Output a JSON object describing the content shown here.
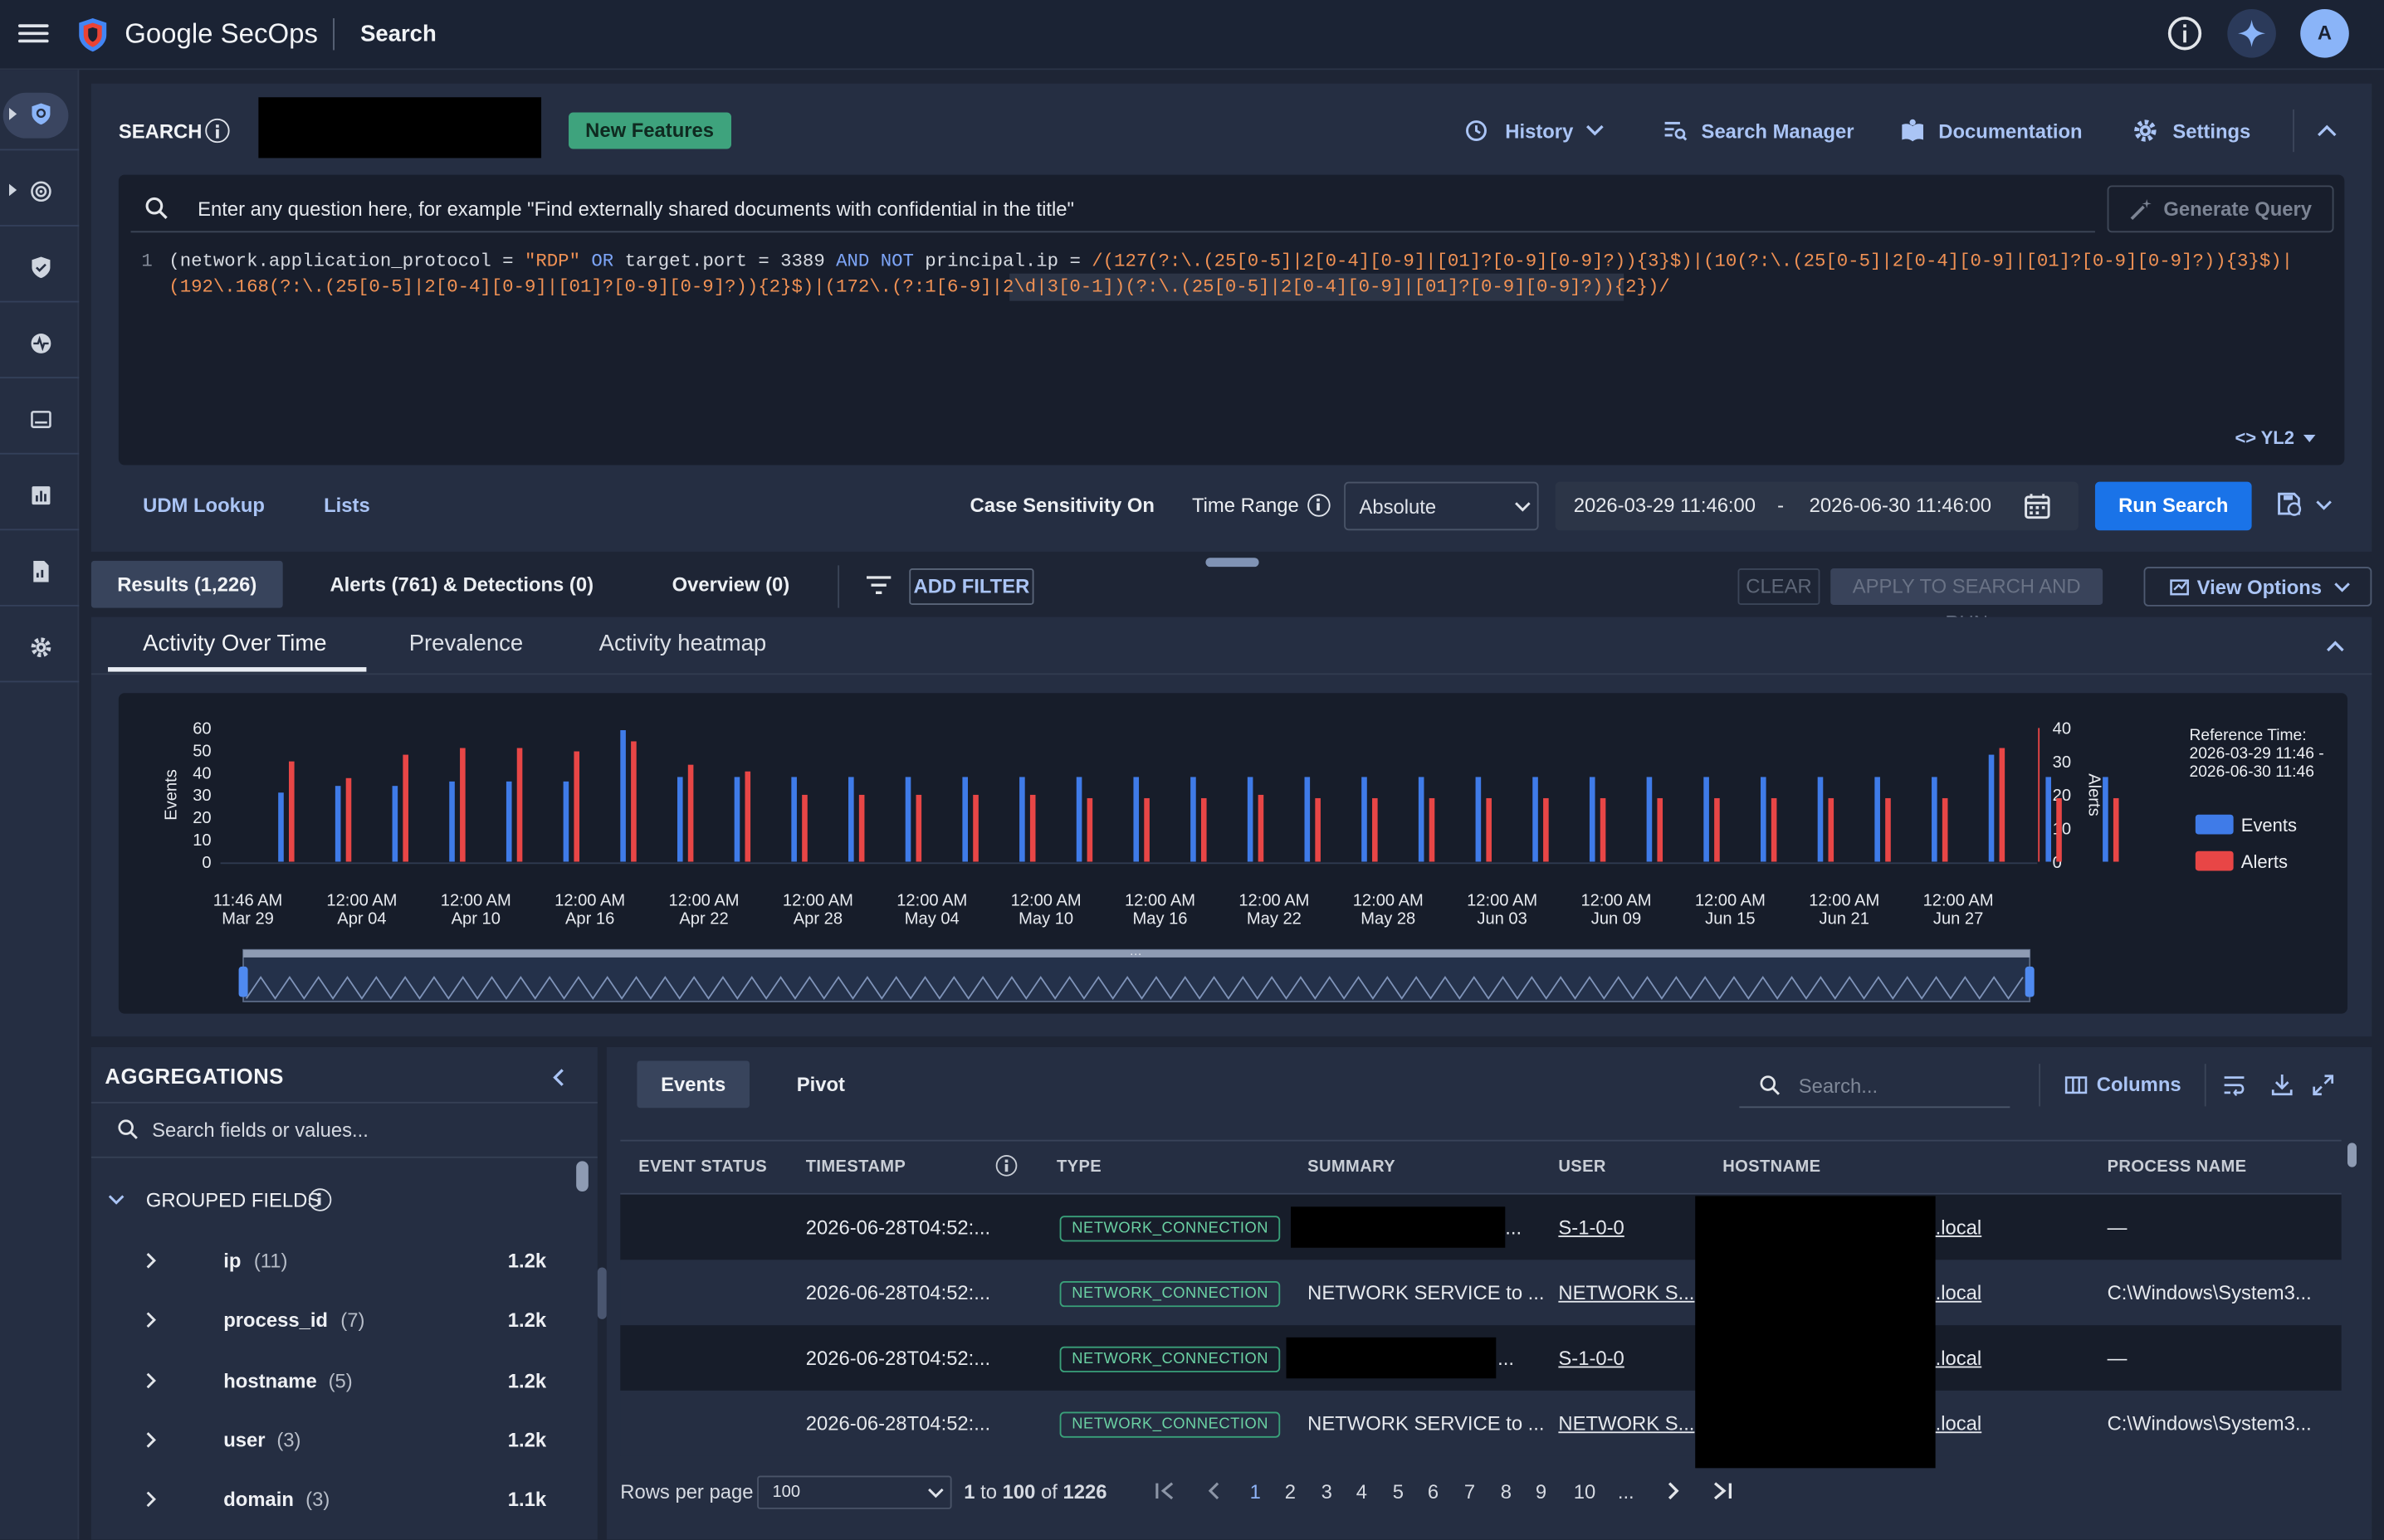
{
  "app": {
    "brand": "Google SecOps",
    "page_title": "Search",
    "avatar_letter": "A"
  },
  "search": {
    "label": "SEARCH",
    "new_features": "New Features",
    "history": "History",
    "search_manager": "Search Manager",
    "documentation": "Documentation",
    "settings": "Settings",
    "nl_placeholder": "Enter any question here, for example \"Find externally shared documents with confidential in the title\"",
    "generate_query": "Generate Query",
    "line_number": "1",
    "query_part1": "(network.application_protocol = ",
    "query_rdp": "\"RDP\"",
    "query_or": " OR ",
    "query_port": "target.port = 3389",
    "query_and_not": " AND NOT ",
    "query_principal": "principal.ip = ",
    "query_regex1": "/(127(?:\\.(25[0-5]|2[0-4][0-9]|[01]?[0-9][0-9]?)){3}$)|(10(?:\\.(25[0-5]|2[0-4][0-9]|[01]?[0-9][0-9]?)){3}$)|",
    "query_regex2": "(192\\.168(?:\\.(25[0-5]|2[0-4][0-9]|[01]?[0-9][0-9]?)){2}$)|(172\\.(?:1[6-9]|2\\d|3[0-1])(?:\\.(25[0-5]|2[0-4][0-9]|[01]?[0-9][0-9]?)){2})/",
    "syntax": "YL2",
    "udm_lookup": "UDM Lookup",
    "lists": "Lists",
    "case_sensitivity": "Case Sensitivity On",
    "time_range_label": "Time Range",
    "time_range_value": "Absolute",
    "start": "2026-03-29 11:46:00",
    "dash": "-",
    "end": "2026-06-30 11:46:00",
    "run_search": "Run Search"
  },
  "results_tabs": {
    "results": "Results (1,226)",
    "alerts": "Alerts (761) & Detections (0)",
    "overview": "Overview (0)",
    "add_filter": "ADD FILTER",
    "clear": "CLEAR",
    "apply": "APPLY TO SEARCH AND RUN",
    "view_options": "View Options"
  },
  "chart_tabs": {
    "activity": "Activity Over Time",
    "prevalence": "Prevalence",
    "heatmap": "Activity heatmap"
  },
  "chart_data": {
    "type": "bar",
    "ylabel_left": "Events",
    "ylabel_right": "Alerts",
    "yticks_left": [
      "60",
      "50",
      "40",
      "30",
      "20",
      "10",
      "0"
    ],
    "yticks_right": [
      "40",
      "30",
      "20",
      "10",
      "0"
    ],
    "ylim_left": [
      0,
      60
    ],
    "ylim_right": [
      0,
      40
    ],
    "xticks": [
      {
        "t": "11:46 AM",
        "d": "Mar 29"
      },
      {
        "t": "12:00 AM",
        "d": "Apr 04"
      },
      {
        "t": "12:00 AM",
        "d": "Apr 10"
      },
      {
        "t": "12:00 AM",
        "d": "Apr 16"
      },
      {
        "t": "12:00 AM",
        "d": "Apr 22"
      },
      {
        "t": "12:00 AM",
        "d": "Apr 28"
      },
      {
        "t": "12:00 AM",
        "d": "May 04"
      },
      {
        "t": "12:00 AM",
        "d": "May 10"
      },
      {
        "t": "12:00 AM",
        "d": "May 16"
      },
      {
        "t": "12:00 AM",
        "d": "May 22"
      },
      {
        "t": "12:00 AM",
        "d": "May 28"
      },
      {
        "t": "12:00 AM",
        "d": "Jun 03"
      },
      {
        "t": "12:00 AM",
        "d": "Jun 09"
      },
      {
        "t": "12:00 AM",
        "d": "Jun 15"
      },
      {
        "t": "12:00 AM",
        "d": "Jun 21"
      },
      {
        "t": "12:00 AM",
        "d": "Jun 27"
      }
    ],
    "series": [
      {
        "name": "Events",
        "color": "#3f7be8",
        "values": [
          31,
          34,
          34,
          36,
          36,
          36,
          59,
          38,
          38,
          38,
          38,
          38,
          38,
          38,
          38,
          38,
          38,
          38,
          38,
          38,
          38,
          38,
          38,
          38,
          38,
          38,
          38,
          38,
          38,
          38,
          48,
          38,
          38
        ]
      },
      {
        "name": "Alerts",
        "color": "#e84646",
        "values": [
          30,
          25,
          32,
          34,
          34,
          33,
          36,
          29,
          27,
          20,
          20,
          20,
          20,
          20,
          19,
          19,
          19,
          20,
          19,
          19,
          19,
          19,
          19,
          19,
          19,
          19,
          19,
          19,
          19,
          19,
          34,
          19,
          19
        ]
      }
    ],
    "reference_label": "Reference Time:",
    "reference_start": "2026-03-29 11:46 -",
    "reference_end": "2026-06-30 11:46"
  },
  "aggregations": {
    "title": "AGGREGATIONS",
    "search_placeholder": "Search fields or values...",
    "grouped_fields": "GROUPED FIELDS",
    "fields": [
      {
        "name": "ip",
        "count": "(11)",
        "value": "1.2k"
      },
      {
        "name": "process_id",
        "count": "(7)",
        "value": "1.2k"
      },
      {
        "name": "hostname",
        "count": "(5)",
        "value": "1.2k"
      },
      {
        "name": "user",
        "count": "(3)",
        "value": "1.2k"
      },
      {
        "name": "domain",
        "count": "(3)",
        "value": "1.1k"
      }
    ]
  },
  "events": {
    "tab_events": "Events",
    "tab_pivot": "Pivot",
    "search_placeholder": "Search...",
    "columns": "Columns",
    "headers": [
      "EVENT STATUS",
      "TIMESTAMP",
      "TYPE",
      "SUMMARY",
      "USER",
      "HOSTNAME",
      "PROCESS NAME"
    ],
    "rows": [
      {
        "ts": "2026-06-28T04:52:...",
        "type": "NETWORK_CONNECTION",
        "summary": "...",
        "user": "S-1-0-0",
        "host": ".local",
        "proc": "—"
      },
      {
        "ts": "2026-06-28T04:52:...",
        "type": "NETWORK_CONNECTION",
        "summary": "NETWORK SERVICE to ...",
        "user": "NETWORK S...",
        "host": ".local",
        "proc": "C:\\Windows\\System3..."
      },
      {
        "ts": "2026-06-28T04:52:...",
        "type": "NETWORK_CONNECTION",
        "summary": "...",
        "user": "S-1-0-0",
        "host": ".local",
        "proc": "—"
      },
      {
        "ts": "2026-06-28T04:52:...",
        "type": "NETWORK_CONNECTION",
        "summary": "NETWORK SERVICE to ...",
        "user": "NETWORK S...",
        "host": ".local",
        "proc": "C:\\Windows\\System3..."
      }
    ],
    "rows_per_page_label": "Rows per page",
    "rows_per_page": "100",
    "range_a": "1",
    "range_to": "to",
    "range_b": "100",
    "range_of": "of",
    "range_total": "1226",
    "pages": [
      "1",
      "2",
      "3",
      "4",
      "5",
      "6",
      "7",
      "8",
      "9",
      "10",
      "..."
    ]
  }
}
